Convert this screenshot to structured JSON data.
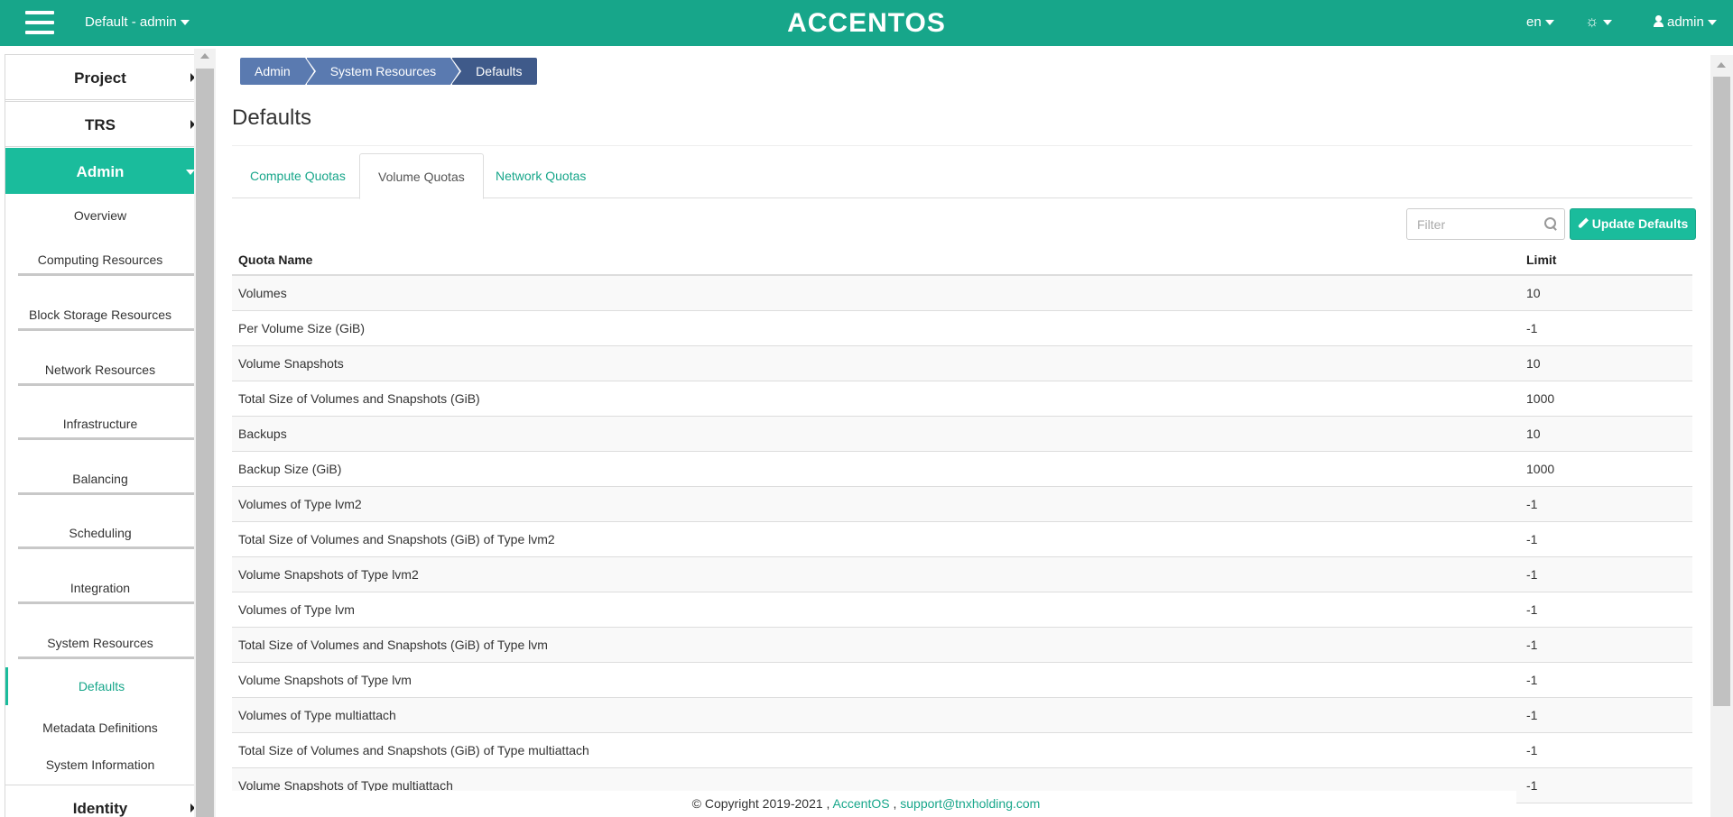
{
  "topbar": {
    "project": "Default - admin",
    "brand": "ACCENTOS",
    "lang": "en",
    "user": "admin"
  },
  "sidebar": {
    "sections": {
      "project": "Project",
      "trs": "TRS",
      "admin": "Admin",
      "identity": "Identity"
    },
    "items": [
      "Overview",
      "Computing Resources",
      "Block Storage Resources",
      "Network Resources",
      "Infrastructure",
      "Balancing",
      "Scheduling",
      "Integration",
      "System Resources",
      "Defaults",
      "Metadata Definitions",
      "System Information"
    ]
  },
  "breadcrumb": [
    "Admin",
    "System Resources",
    "Defaults"
  ],
  "page": {
    "title": "Defaults"
  },
  "tabs": [
    "Compute Quotas",
    "Volume Quotas",
    "Network Quotas"
  ],
  "filter": {
    "placeholder": "Filter"
  },
  "update_button": "Update Defaults",
  "table": {
    "headers": [
      "Quota Name",
      "Limit"
    ],
    "rows": [
      [
        "Volumes",
        "10"
      ],
      [
        "Per Volume Size (GiB)",
        "-1"
      ],
      [
        "Volume Snapshots",
        "10"
      ],
      [
        "Total Size of Volumes and Snapshots (GiB)",
        "1000"
      ],
      [
        "Backups",
        "10"
      ],
      [
        "Backup Size (GiB)",
        "1000"
      ],
      [
        "Volumes of Type lvm2",
        "-1"
      ],
      [
        "Total Size of Volumes and Snapshots (GiB) of Type lvm2",
        "-1"
      ],
      [
        "Volume Snapshots of Type lvm2",
        "-1"
      ],
      [
        "Volumes of Type lvm",
        "-1"
      ],
      [
        "Total Size of Volumes and Snapshots (GiB) of Type lvm",
        "-1"
      ],
      [
        "Volume Snapshots of Type lvm",
        "-1"
      ],
      [
        "Volumes of Type multiattach",
        "-1"
      ],
      [
        "Total Size of Volumes and Snapshots (GiB) of Type multiattach",
        "-1"
      ],
      [
        "Volume Snapshots of Type multiattach",
        "-1"
      ]
    ]
  },
  "footer": {
    "copyright": "© Copyright 2019-2021 ,",
    "link1": "AccentOS",
    "sep": ",",
    "link2": "support@tnxholding.com"
  },
  "colors": {
    "brand": "#17a68a",
    "accent": "#1abc9c",
    "breadcrumb": "#5a7ab0"
  }
}
